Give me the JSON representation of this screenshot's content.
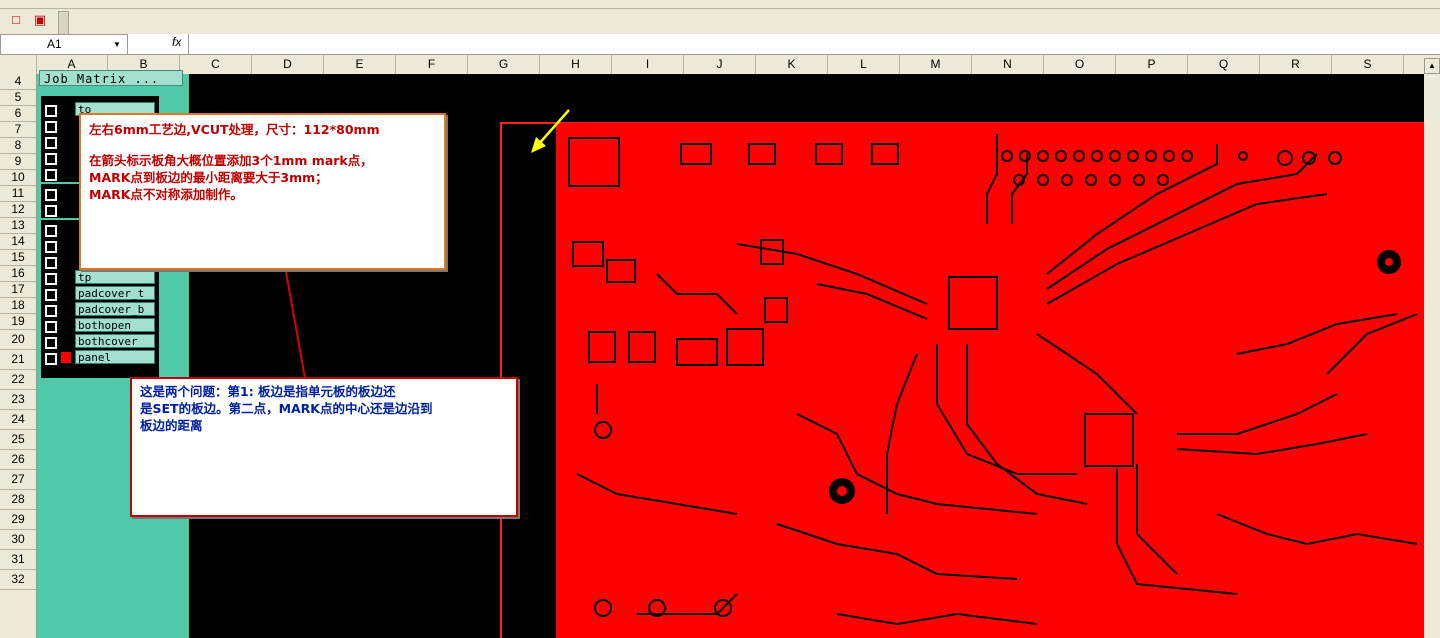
{
  "toolbar": {
    "pdf_icon": "pdf-icon",
    "pdf_alt_icon": "pdf-annotate-icon"
  },
  "formula_bar": {
    "name_box": "A1",
    "fx": "fx",
    "formula": ""
  },
  "columns": [
    "A",
    "B",
    "C",
    "D",
    "E",
    "F",
    "G",
    "H",
    "I",
    "J",
    "K",
    "L",
    "M",
    "N",
    "O",
    "P",
    "Q",
    "R",
    "S"
  ],
  "rows": [
    "4",
    "5",
    "6",
    "7",
    "8",
    "9",
    "10",
    "11",
    "12",
    "13",
    "14",
    "15",
    "16",
    "17",
    "18",
    "19",
    "20",
    "21",
    "22",
    "23",
    "24",
    "25",
    "26",
    "27",
    "28",
    "29",
    "30",
    "31",
    "32"
  ],
  "job_matrix": {
    "title": "Job Matrix ..."
  },
  "layers": [
    {
      "name": "to"
    },
    {
      "name": ""
    },
    {
      "name": ""
    },
    {
      "name": ""
    },
    {
      "name": ""
    },
    {
      "name": ""
    },
    {
      "name": ""
    },
    {
      "name": ""
    },
    {
      "name": ""
    },
    {
      "name": ""
    },
    {
      "name": "tp"
    },
    {
      "name": "padcover_t"
    },
    {
      "name": "padcover_b"
    },
    {
      "name": "bothopen"
    },
    {
      "name": "bothcover"
    },
    {
      "name": "panel"
    }
  ],
  "callout_1": {
    "line1": "左右6mm工艺边,VCUT处理，尺寸：112*80mm",
    "line2": "在箭头标示板角大概位置添加3个1mm mark点，",
    "line3": "MARK点到板边的最小距离要大于3mm；",
    "line4": "MARK点不对称添加制作。"
  },
  "callout_2": {
    "line1": "这是两个问题：第1: 板边是指单元板的板边还",
    "line2": "是SET的板边。第二点，MARK点的中心还是边沿到",
    "line3": "板边的距离"
  },
  "colors": {
    "pcb_copper": "#ff0000",
    "background": "#000000",
    "panel_bg": "#4fc9a8",
    "arrow_yellow": "#ffff00",
    "arrow_red": "#e00000"
  }
}
